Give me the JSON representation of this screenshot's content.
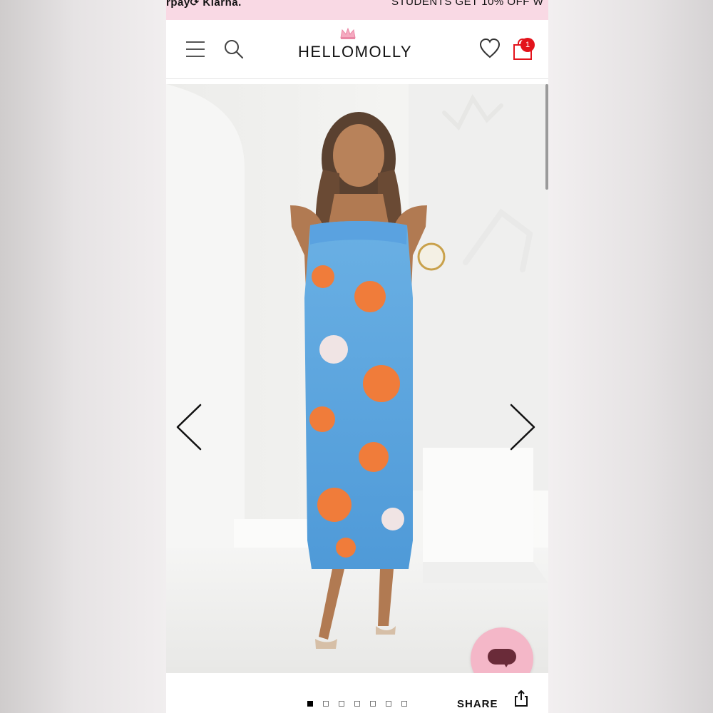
{
  "promo": {
    "left_text": "rpay⟳ Klarna.",
    "right_text": "STUDENTS GET 10% OFF W"
  },
  "header": {
    "menu_icon": "menu-icon",
    "search_icon": "search-icon",
    "logo_text": "HELLOMOLLY",
    "wishlist_icon": "heart-icon",
    "cart_icon": "bag-icon",
    "cart_count": "1"
  },
  "gallery": {
    "prev_icon": "chevron-left-icon",
    "next_icon": "chevron-right-icon",
    "image_label": "product-photo",
    "dots_total": 7,
    "active_dot": 0
  },
  "actions": {
    "share_label": "SHARE",
    "share_icon": "share-icon",
    "chat_icon": "chat-icon"
  },
  "colors": {
    "promo_bg": "#f9d9e4",
    "badge": "#e3131c",
    "chat_bg": "#f4b7c8",
    "chat_icon": "#6a2b39"
  }
}
